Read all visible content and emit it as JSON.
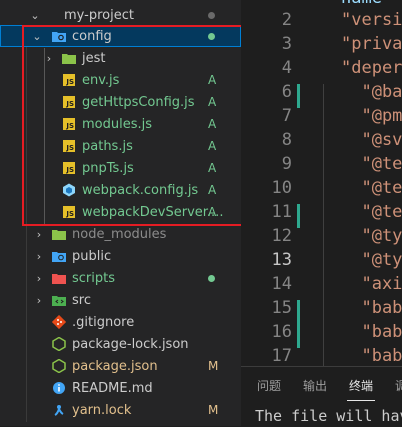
{
  "explorer": {
    "root": {
      "label": "my-project",
      "chevron": "⌄"
    },
    "selected_folder": {
      "label": "config",
      "chevron": "⌄"
    },
    "items": [
      {
        "label": "jest",
        "type": "folder",
        "status": ""
      },
      {
        "label": "env.js",
        "type": "js",
        "status": "A"
      },
      {
        "label": "getHttpsConfig.js",
        "type": "js",
        "status": "A"
      },
      {
        "label": "modules.js",
        "type": "js",
        "status": "A"
      },
      {
        "label": "paths.js",
        "type": "js",
        "status": "A"
      },
      {
        "label": "pnpTs.js",
        "type": "js",
        "status": "A"
      },
      {
        "label": "webpack.config.js",
        "type": "webpack",
        "status": "A"
      },
      {
        "label": "webpackDevServer....",
        "type": "js",
        "status": "A"
      }
    ],
    "siblings": [
      {
        "label": "node_modules",
        "type": "folder",
        "status": ""
      },
      {
        "label": "public",
        "type": "folder-public",
        "status": ""
      },
      {
        "label": "scripts",
        "type": "folder",
        "status": "",
        "dot": true
      },
      {
        "label": "src",
        "type": "folder-src",
        "status": ""
      },
      {
        "label": ".gitignore",
        "type": "git",
        "status": ""
      },
      {
        "label": "package-lock.json",
        "type": "json",
        "status": ""
      },
      {
        "label": "package.json",
        "type": "json",
        "status": "M"
      },
      {
        "label": "README.md",
        "type": "info",
        "status": ""
      },
      {
        "label": "yarn.lock",
        "type": "yarn",
        "status": "M"
      }
    ]
  },
  "editor": {
    "lines": [
      {
        "num": "2",
        "text": "\"versi"
      },
      {
        "num": "3",
        "text": "\"priva"
      },
      {
        "num": "4",
        "text": "\"deper"
      },
      {
        "num": "6",
        "text": "  \"@ba"
      },
      {
        "num": "7",
        "text": "  \"@pm"
      },
      {
        "num": "8",
        "text": "  \"@sv"
      },
      {
        "num": "9",
        "text": "  \"@te"
      },
      {
        "num": "10",
        "text": "  \"@te"
      },
      {
        "num": "11",
        "text": "  \"@te"
      },
      {
        "num": "12",
        "text": "  \"@ty"
      },
      {
        "num": "13",
        "text": "  \"@ty"
      },
      {
        "num": "14",
        "text": "  \"axi"
      },
      {
        "num": "15",
        "text": "  \"bab"
      },
      {
        "num": "16",
        "text": "  \"bab"
      },
      {
        "num": "17",
        "text": "  \"bab"
      }
    ],
    "top_partial": "name"
  },
  "panel": {
    "tabs": [
      "问题",
      "输出",
      "终端",
      "调"
    ],
    "active_tab": "终端",
    "terminal_text": "The file will hav"
  },
  "colors": {
    "accent": "#007fd4",
    "added": "#73c991",
    "modified": "#e2c08d",
    "highlight": "#e51c23"
  }
}
